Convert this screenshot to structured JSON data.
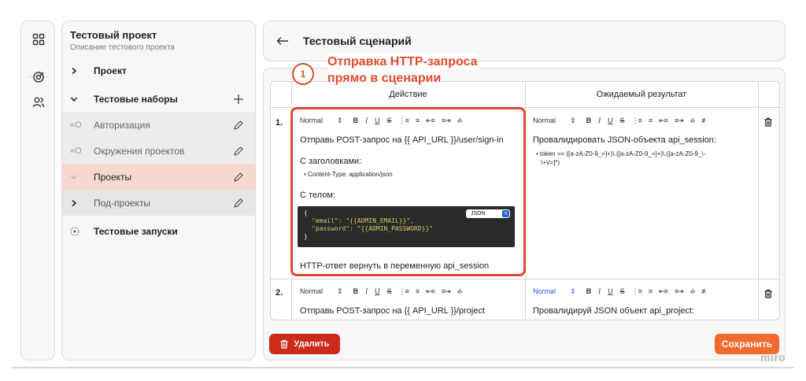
{
  "project": {
    "title": "Тестовый проект",
    "subtitle": "Описание тестового проекта"
  },
  "sidebar": {
    "items": [
      {
        "label": "Проект"
      },
      {
        "label": "Тестовые наборы"
      },
      {
        "label": "Авторизация"
      },
      {
        "label": "Окружения проектов"
      },
      {
        "label": "Проекты"
      },
      {
        "label": "Под-проекты"
      },
      {
        "label": "Тестовые запуски"
      }
    ]
  },
  "header": {
    "title": "Тестовый сценарий"
  },
  "annotation": {
    "step": "1",
    "line1": "Отправка HTTP-запроса",
    "line2": "прямо в сценарии"
  },
  "table": {
    "col_action": "Действие",
    "col_expected": "Ожидаемый результат",
    "toolbar": {
      "format": "Normal",
      "bold": "B",
      "italic": "I",
      "underline": "U",
      "strike": "S"
    },
    "rows": [
      {
        "num": "1.",
        "action": {
          "line1": "Отправь POST-запрос на {{ API_URL }}/user/sign-in",
          "headers_title": "С заголовками:",
          "header_item": "• Content-Type: application/json",
          "body_title": "С телом:",
          "code_open": "{",
          "code_email": "\"email\": \"{{ADMIN_EMAIL}}\",",
          "code_password": "\"password\": \"{{ADMIN_PASSWORD}}\"",
          "code_close": "}",
          "code_lang": "JSON",
          "last": "HTTP-ответ вернуть в переменную api_session"
        },
        "expected": {
          "line1": "Провалидировать JSON-объекта api_session:",
          "item1": "• token == ([a-zA-Z0-9_=]+)\\.([a-zA-Z0-9_=]+)\\.([a-zA-Z0-9_\\-",
          "item2": "\\+\\/=]*)"
        }
      },
      {
        "num": "2.",
        "action": {
          "line1": "Отправь POST-запрос на {{ API_URL }}/project"
        },
        "expected": {
          "line1": "Провалидируй JSON объект api_project:"
        }
      }
    ]
  },
  "buttons": {
    "delete": "Удалить",
    "save": "Сохранить"
  },
  "watermark": "miro",
  "colors": {
    "accent": "#e04a2c",
    "delete": "#cc2b1c",
    "save": "#f36a2e",
    "active_row": "#f5d9d0"
  }
}
